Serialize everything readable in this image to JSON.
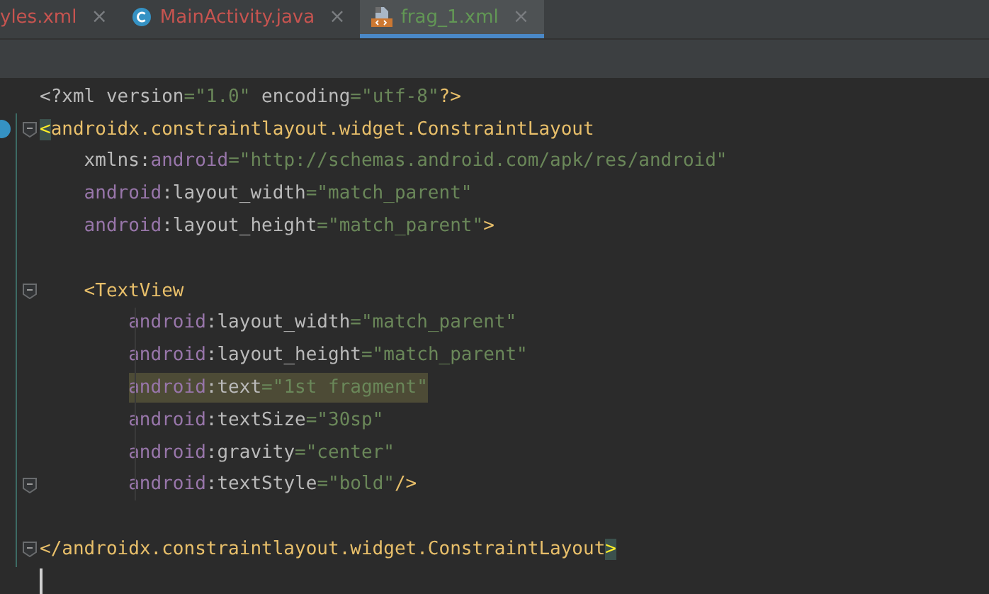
{
  "tabs": [
    {
      "label": "yles.xml",
      "kind": "plain",
      "color": "#c75450",
      "selected": false,
      "close": "×"
    },
    {
      "label": "MainActivity.java",
      "kind": "class",
      "color": "#c75450",
      "selected": false,
      "close": "×"
    },
    {
      "label": "frag_1.xml",
      "kind": "xml",
      "color": "#629755",
      "selected": true,
      "close": "×"
    }
  ],
  "code": [
    {
      "kind": "text",
      "tokens": [
        {
          "kind": "plain",
          "text": "<?xml version"
        },
        {
          "kind": "str",
          "text": "=\"1.0\""
        },
        {
          "kind": "plain",
          "text": " encoding"
        },
        {
          "kind": "str",
          "text": "=\"utf-8\""
        },
        {
          "kind": "tag",
          "text": "?>"
        }
      ]
    },
    {
      "kind": "text",
      "foldable": true,
      "gutter_icon": true,
      "tokens": [
        {
          "text": "<",
          "matched": true
        },
        {
          "kind": "tag",
          "text": "androidx.constraintlayout.widget.ConstraintLayout"
        }
      ],
      "children": [
        {
          "kind": "text",
          "tokens": [
            {
              "kind": "attr",
              "text": "xmlns:"
            },
            {
              "kind": "ns",
              "text": "android"
            },
            {
              "kind": "str",
              "text": "=\"http://schemas.android.com/apk/res/android\""
            }
          ]
        },
        {
          "kind": "text",
          "tokens": [
            {
              "kind": "ns",
              "text": "android"
            },
            {
              "kind": "attr",
              "text": ":layout_width"
            },
            {
              "kind": "str",
              "text": "=\"match_parent\""
            }
          ]
        },
        {
          "kind": "text",
          "tokens": [
            {
              "kind": "ns",
              "text": "android"
            },
            {
              "kind": "attr",
              "text": ":layout_height"
            },
            {
              "kind": "str",
              "text": "=\"match_parent\""
            },
            {
              "kind": "tag",
              "text": ">"
            }
          ]
        },
        {
          "kind": "blank"
        },
        {
          "kind": "text",
          "foldable": true,
          "tokens": [
            {
              "kind": "tag",
              "text": "<TextView"
            }
          ],
          "children": [
            {
              "kind": "text",
              "tokens": [
                {
                  "kind": "ns",
                  "text": "android"
                },
                {
                  "kind": "attr",
                  "text": ":layout_width"
                },
                {
                  "kind": "str",
                  "text": "=\"match_parent\""
                }
              ]
            },
            {
              "kind": "text",
              "tokens": [
                {
                  "kind": "ns",
                  "text": "android"
                },
                {
                  "kind": "attr",
                  "text": ":layout_height"
                },
                {
                  "kind": "str",
                  "text": "=\"match_parent\""
                }
              ]
            },
            {
              "kind": "text",
              "highlighted": true,
              "tokens": [
                {
                  "kind": "ns",
                  "text": "android"
                },
                {
                  "kind": "attr",
                  "text": ":text"
                },
                {
                  "kind": "str",
                  "text": "=\"1st fragment\""
                }
              ]
            },
            {
              "kind": "text",
              "tokens": [
                {
                  "kind": "ns",
                  "text": "android"
                },
                {
                  "kind": "attr",
                  "text": ":textSize"
                },
                {
                  "kind": "str",
                  "text": "=\"30sp\""
                }
              ]
            },
            {
              "kind": "text",
              "tokens": [
                {
                  "kind": "ns",
                  "text": "android"
                },
                {
                  "kind": "attr",
                  "text": ":gravity"
                },
                {
                  "kind": "str",
                  "text": "=\"center\""
                }
              ]
            },
            {
              "kind": "text",
              "foldable": true,
              "tokens": [
                {
                  "kind": "ns",
                  "text": "android"
                },
                {
                  "kind": "attr",
                  "text": ":textStyle"
                },
                {
                  "kind": "str",
                  "text": "=\"bold\""
                },
                {
                  "kind": "tag",
                  "text": "/>"
                }
              ]
            }
          ]
        },
        {
          "kind": "blank"
        }
      ]
    },
    {
      "kind": "text",
      "foldable": true,
      "tokens": [
        {
          "kind": "tag",
          "text": "</androidx.constraintlayout.widget.ConstraintLayout"
        },
        {
          "text": ">",
          "matched": true
        }
      ]
    },
    {
      "kind": "cursor"
    }
  ]
}
